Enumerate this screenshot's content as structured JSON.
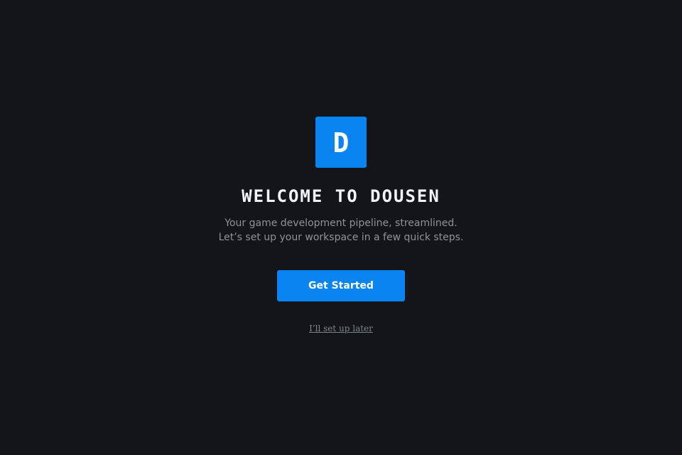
{
  "logo": {
    "letter": "D",
    "color": "#0a84f0"
  },
  "welcome": {
    "title": "WELCOME TO DOUSEN",
    "subtitle_lines": [
      "Your game development pipeline, streamlined.",
      "Let’s set up your workspace in a few quick steps."
    ],
    "primary_button_label": "Get Started",
    "skip_link_label": "I’ll set up later"
  },
  "colors": {
    "background": "#131519",
    "accent": "#0a84f0",
    "title_text": "#f1f3f5",
    "muted_text": "#8d939b"
  }
}
